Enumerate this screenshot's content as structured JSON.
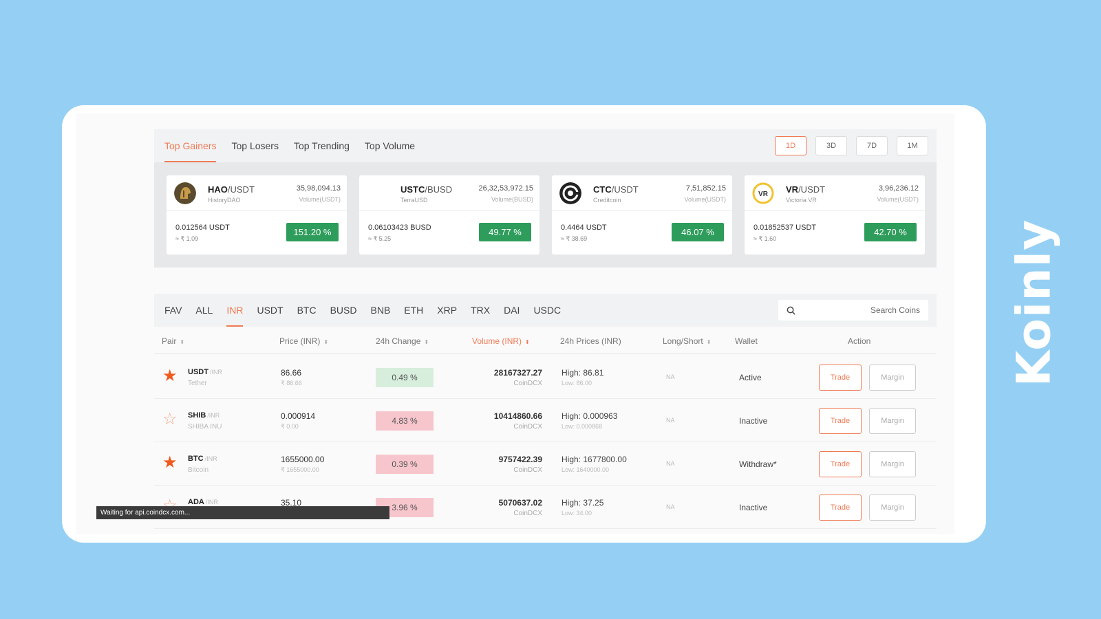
{
  "brand": {
    "name": "Koinly"
  },
  "top": {
    "tabs": [
      "Top Gainers",
      "Top Losers",
      "Top Trending",
      "Top Volume"
    ],
    "active_tab": "Top Gainers",
    "periods": [
      "1D",
      "3D",
      "7D",
      "1M"
    ],
    "active_period": "1D",
    "gainers": [
      {
        "base": "HAO",
        "quote": "/USDT",
        "name": "HistoryDAO",
        "volume": "35,98,094.13",
        "volume_label": "Volume(USDT)",
        "price": "0.012564 USDT",
        "inr": "≈ ₹ 1.09",
        "change": "151.20 %",
        "logo": "helmet-logo",
        "logo_color": "#5a4a2e"
      },
      {
        "base": "USTC",
        "quote": "/BUSD",
        "name": "TerraUSD",
        "volume": "26,32,53,972.15",
        "volume_label": "Volume(BUSD)",
        "price": "0.06103423 BUSD",
        "inr": "≈ ₹ 5.25",
        "change": "49.77 %",
        "logo": "none",
        "logo_color": "#ffffff"
      },
      {
        "base": "CTC",
        "quote": "/USDT",
        "name": "Creditcoin",
        "volume": "7,51,852.15",
        "volume_label": "Volume(USDT)",
        "price": "0.4464 USDT",
        "inr": "≈ ₹ 38.69",
        "change": "46.07 %",
        "logo": "ctc-logo",
        "logo_color": "#222222"
      },
      {
        "base": "VR",
        "quote": "/USDT",
        "name": "Victoria VR",
        "volume": "3,96,236.12",
        "volume_label": "Volume(USDT)",
        "price": "0.01852537 USDT",
        "inr": "≈ ₹ 1.60",
        "change": "42.70 %",
        "logo": "vr-logo",
        "logo_color": "#f2c230"
      }
    ]
  },
  "market": {
    "tabs": [
      "FAV",
      "ALL",
      "INR",
      "USDT",
      "BTC",
      "BUSD",
      "BNB",
      "ETH",
      "XRP",
      "TRX",
      "DAI",
      "USDC"
    ],
    "active_tab": "INR",
    "search_placeholder": "Search Coins",
    "columns": {
      "pair": "Pair",
      "price": "Price (INR)",
      "change": "24h Change",
      "volume": "Volume (INR)",
      "prices": "24h Prices (INR)",
      "longshort": "Long/Short",
      "wallet": "Wallet",
      "action": "Action"
    },
    "sort_glyph": "⬍",
    "rows": [
      {
        "fav": true,
        "symbol": "USDT",
        "quote": "/INR",
        "name": "Tether",
        "price": "86.66",
        "price_inr": "₹ 86.66",
        "change": "0.49 %",
        "direction": "up",
        "volume": "28167327.27",
        "source": "CoinDCX",
        "high": "High: 86.81",
        "low": "Low: 86.00",
        "longshort": "NA",
        "wallet": "Active",
        "trade": "Trade",
        "margin": "Margin"
      },
      {
        "fav": false,
        "symbol": "SHIB",
        "quote": "/INR",
        "name": "SHIBA INU",
        "price": "0.000914",
        "price_inr": "₹ 0.00",
        "change": "4.83 %",
        "direction": "down",
        "volume": "10414860.66",
        "source": "CoinDCX",
        "high": "High: 0.000963",
        "low": "Low: 0.000868",
        "longshort": "NA",
        "wallet": "Inactive",
        "trade": "Trade",
        "margin": "Margin"
      },
      {
        "fav": true,
        "symbol": "BTC",
        "quote": "/INR",
        "name": "Bitcoin",
        "price": "1655000.00",
        "price_inr": "₹ 1655000.00",
        "change": "0.39 %",
        "direction": "down",
        "volume": "9757422.39",
        "source": "CoinDCX",
        "high": "High: 1677800.00",
        "low": "Low: 1640000.00",
        "longshort": "NA",
        "wallet": "Withdraw*",
        "trade": "Trade",
        "margin": "Margin"
      },
      {
        "fav": false,
        "symbol": "ADA",
        "quote": "/INR",
        "name": "",
        "price": "35.10",
        "price_inr": "",
        "change": "3.96 %",
        "direction": "down",
        "volume": "5070637.02",
        "source": "CoinDCX",
        "high": "High: 37.25",
        "low": "Low: 34.00",
        "longshort": "NA",
        "wallet": "Inactive",
        "trade": "Trade",
        "margin": "Margin"
      }
    ]
  },
  "status": {
    "text": "Waiting for api.coindcx.com..."
  },
  "colors": {
    "accent": "#ef7b55",
    "green": "#2e9c5b",
    "page_bg": "#95d0f4"
  }
}
